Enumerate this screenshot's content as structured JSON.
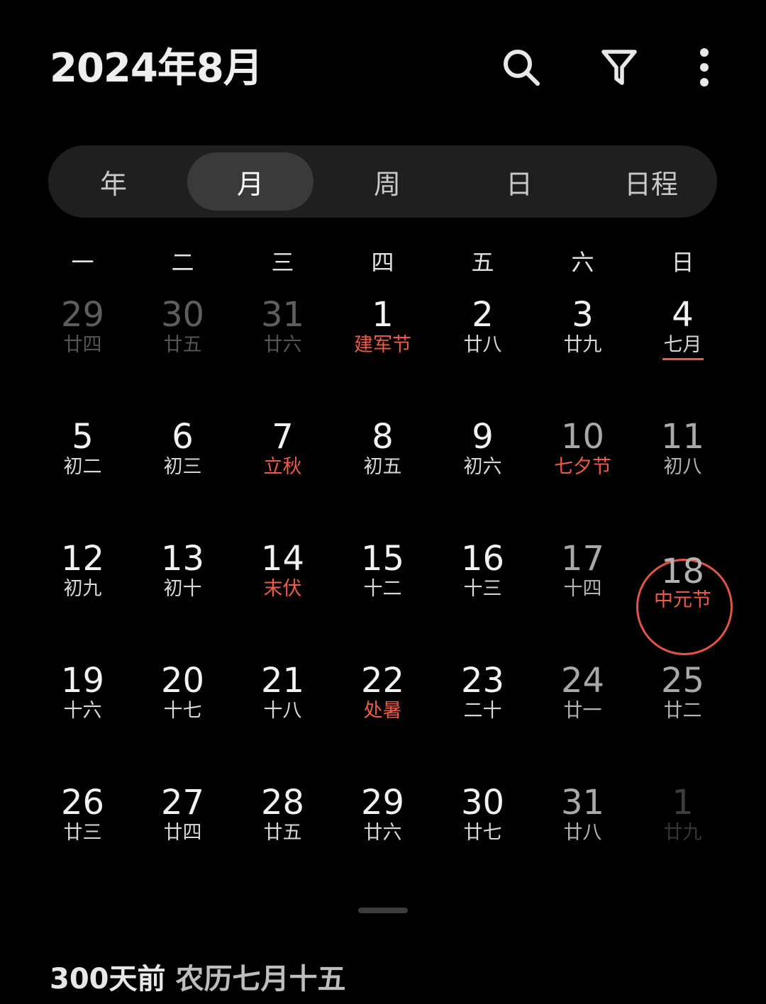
{
  "header": {
    "title": "2024年8月",
    "icons": [
      "search-icon",
      "filter-icon",
      "more-vert-icon"
    ]
  },
  "view_tabs": [
    {
      "label": "年"
    },
    {
      "label": "月",
      "selected": true
    },
    {
      "label": "周"
    },
    {
      "label": "日"
    },
    {
      "label": "日程"
    }
  ],
  "weekdays": [
    "一",
    "二",
    "三",
    "四",
    "五",
    "六",
    "日"
  ],
  "weeks": [
    [
      {
        "day": "29",
        "lunar": "廿四",
        "state": "other"
      },
      {
        "day": "30",
        "lunar": "廿五",
        "state": "other"
      },
      {
        "day": "31",
        "lunar": "廿六",
        "state": "other"
      },
      {
        "day": "1",
        "lunar": "建军节",
        "festival": true
      },
      {
        "day": "2",
        "lunar": "廿八"
      },
      {
        "day": "3",
        "lunar": "廿九"
      },
      {
        "day": "4",
        "lunar": "七月",
        "month_start": true
      }
    ],
    [
      {
        "day": "5",
        "lunar": "初二"
      },
      {
        "day": "6",
        "lunar": "初三"
      },
      {
        "day": "7",
        "lunar": "立秋",
        "festival": true
      },
      {
        "day": "8",
        "lunar": "初五"
      },
      {
        "day": "9",
        "lunar": "初六"
      },
      {
        "day": "10",
        "lunar": "七夕节",
        "festival": true,
        "state": "dim"
      },
      {
        "day": "11",
        "lunar": "初八",
        "state": "dim"
      }
    ],
    [
      {
        "day": "12",
        "lunar": "初九"
      },
      {
        "day": "13",
        "lunar": "初十"
      },
      {
        "day": "14",
        "lunar": "末伏",
        "festival": true
      },
      {
        "day": "15",
        "lunar": "十二"
      },
      {
        "day": "16",
        "lunar": "十三"
      },
      {
        "day": "17",
        "lunar": "十四",
        "state": "dim"
      },
      {
        "day": "18",
        "lunar": "中元节",
        "festival": true,
        "today": true
      }
    ],
    [
      {
        "day": "19",
        "lunar": "十六"
      },
      {
        "day": "20",
        "lunar": "十七"
      },
      {
        "day": "21",
        "lunar": "十八"
      },
      {
        "day": "22",
        "lunar": "处暑",
        "festival": true
      },
      {
        "day": "23",
        "lunar": "二十"
      },
      {
        "day": "24",
        "lunar": "廿一",
        "state": "dim"
      },
      {
        "day": "25",
        "lunar": "廿二",
        "state": "dim"
      }
    ],
    [
      {
        "day": "26",
        "lunar": "廿三"
      },
      {
        "day": "27",
        "lunar": "廿四"
      },
      {
        "day": "28",
        "lunar": "廿五"
      },
      {
        "day": "29",
        "lunar": "廿六"
      },
      {
        "day": "30",
        "lunar": "廿七"
      },
      {
        "day": "31",
        "lunar": "廿八",
        "state": "dim"
      },
      {
        "day": "1",
        "lunar": "廿九",
        "state": "next"
      }
    ]
  ],
  "footer": {
    "relative": "300天前",
    "lunar_date": "农历七月十五"
  },
  "colors": {
    "background": "#000000",
    "accent_red": "#ef5a44",
    "tab_track": "#1f1f1f",
    "tab_selected": "#3a3a3a"
  }
}
